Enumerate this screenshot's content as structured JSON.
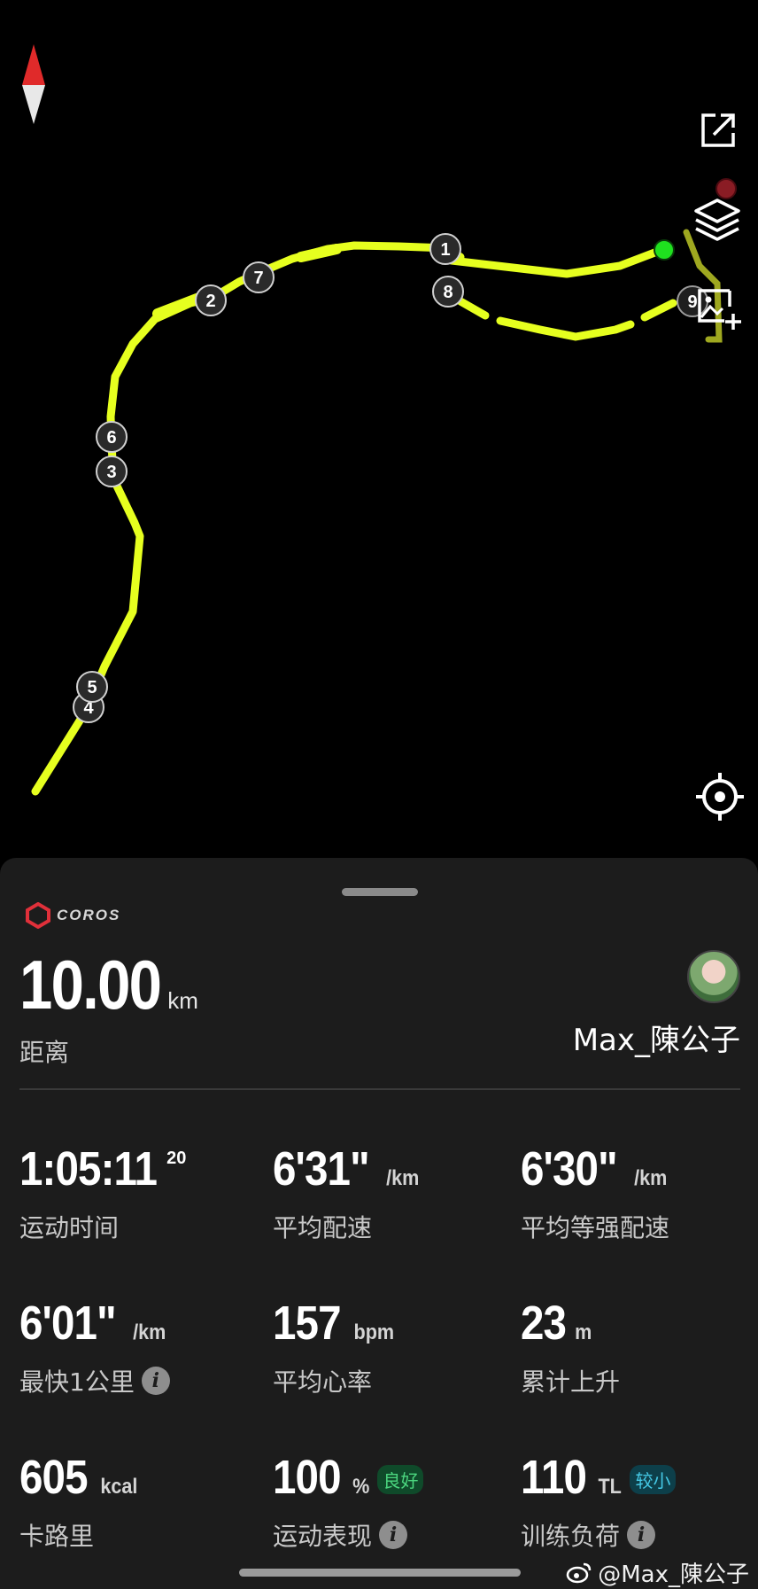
{
  "map": {
    "route_color": "#e6ff1f",
    "start_dot_color": "#1fe01f",
    "end_dot_color": "#8a1c24",
    "lap_markers": [
      "1",
      "2",
      "3",
      "4",
      "5",
      "6",
      "7",
      "8",
      "9"
    ]
  },
  "brand": {
    "name": "COROS",
    "color": "#e0303a"
  },
  "summary": {
    "distance_value": "10.00",
    "distance_unit": "km",
    "distance_label": "距离",
    "username": "Max_陳公子"
  },
  "stats": [
    {
      "value": "1:05:11",
      "sup": "20",
      "unit": "",
      "label": "运动时间",
      "badge": "",
      "info": false
    },
    {
      "value": "6'31\"",
      "sup": "",
      "unit": "/km",
      "label": "平均配速",
      "badge": "",
      "info": false
    },
    {
      "value": "6'30\"",
      "sup": "",
      "unit": "/km",
      "label": "平均等强配速",
      "badge": "",
      "info": false
    },
    {
      "value": "6'01\"",
      "sup": "",
      "unit": "/km",
      "label": "最快1公里",
      "badge": "",
      "info": true
    },
    {
      "value": "157",
      "sup": "",
      "unit": "bpm",
      "label": "平均心率",
      "badge": "",
      "info": false
    },
    {
      "value": "23",
      "sup": "",
      "unit": "m",
      "label": "累计上升",
      "badge": "",
      "info": false
    },
    {
      "value": "605",
      "sup": "",
      "unit": "kcal",
      "label": "卡路里",
      "badge": "",
      "info": false
    },
    {
      "value": "100",
      "sup": "",
      "unit": "%",
      "label": "运动表现",
      "badge": "良好",
      "info": true
    },
    {
      "value": "110",
      "sup": "",
      "unit": "TL",
      "label": "训练负荷",
      "badge": "较小",
      "info": true
    }
  ],
  "info_glyph": "i",
  "watermark": "@Max_陳公子"
}
